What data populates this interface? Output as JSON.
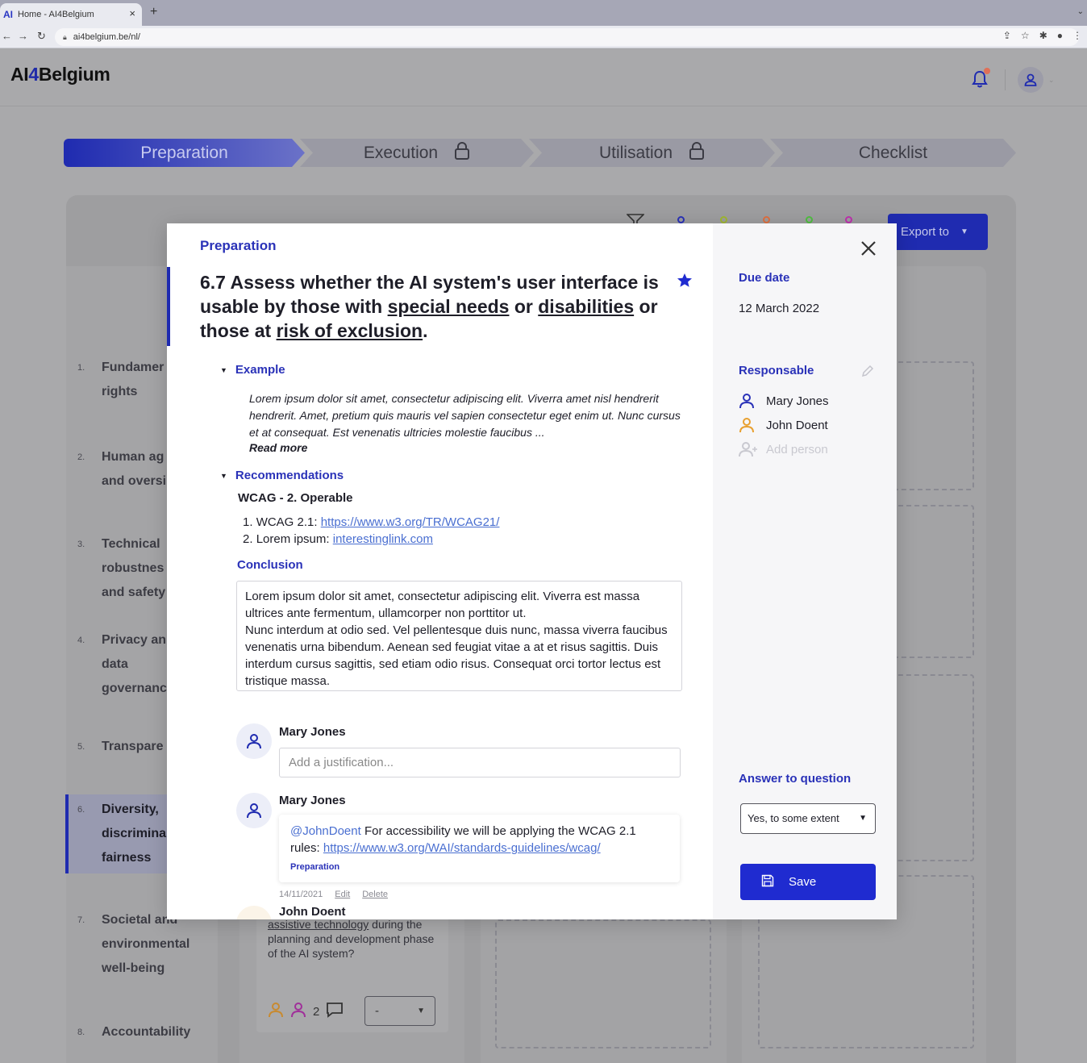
{
  "browser": {
    "tab_title": "Home - AI4Belgium",
    "favicon": "AI",
    "url": "ai4belgium.be/nl/",
    "new_tab": "+",
    "close_tab": "×"
  },
  "header": {
    "logo_part1": "AI",
    "logo_part2": "4",
    "logo_part3": "Belgium"
  },
  "stages": [
    {
      "label": "Preparation",
      "locked": false,
      "active": true
    },
    {
      "label": "Execution",
      "locked": true,
      "active": false
    },
    {
      "label": "Utilisation",
      "locked": true,
      "active": false
    },
    {
      "label": "Checklist",
      "locked": false,
      "active": false
    }
  ],
  "toolbar": {
    "export_label": "Export to",
    "filter_dot_colors": [
      "#2a32b8",
      "#a0b830",
      "#e07040",
      "#50c040",
      "#c030b0"
    ]
  },
  "sidebar": {
    "items": [
      {
        "num": "1.",
        "label": "Fundamer\nrights"
      },
      {
        "num": "2.",
        "label": "Human ag\nand oversi"
      },
      {
        "num": "3.",
        "label": "Technical\nrobustnes\nand safety"
      },
      {
        "num": "4.",
        "label": "Privacy an\ndata\ngovernanc"
      },
      {
        "num": "5.",
        "label": "Transpare"
      },
      {
        "num": "6.",
        "label": "Diversity,\ndiscrimina\nfairness"
      },
      {
        "num": "7.",
        "label": "Societal and\nenvironmental\nwell-being"
      },
      {
        "num": "8.",
        "label": "Accountability"
      }
    ]
  },
  "bg_card": {
    "text_underlined": "assistive technology",
    "text_rest": " during the planning and development phase of the AI system?",
    "comment_count": "2",
    "select_value": "-"
  },
  "modal": {
    "breadcrumb": "Preparation",
    "title_part1": "6.7 Assess whether the AI system's user interface is usable by those with ",
    "title_link1": "special needs",
    "title_part2": " or ",
    "title_link2": "disabilities",
    "title_part3": " or those at ",
    "title_link3": "risk of exclusion",
    "title_part4": ".",
    "example_heading": "Example",
    "example_text": "Lorem ipsum dolor sit amet, consectetur adipiscing elit. Viverra amet nisl hendrerit hendrerit. Amet, pretium quis mauris vel sapien consectetur eget enim ut. Nunc cursus et at consequat. Est venenatis ultricies molestie faucibus ...",
    "read_more": "Read more",
    "recommendations_heading": "Recommendations",
    "wcag_heading": "WCAG - 2. Operable",
    "recommendations": [
      {
        "num": "1.",
        "prefix": "WCAG 2.1: ",
        "link": "https://www.w3.org/TR/WCAG21/"
      },
      {
        "num": "2.",
        "prefix": "Lorem ipsum: ",
        "link": "interestinglink.com"
      }
    ],
    "conclusion_heading": "Conclusion",
    "conclusion_text_1": "Lorem ipsum dolor sit amet, consectetur adipiscing elit. Viverra est massa ultrices ante fermentum, ullamcorper non porttitor ut.",
    "conclusion_text_2": "Nunc interdum at odio sed. Vel pellentesque duis nunc, massa viverra faucibus venenatis urna bibendum. Aenean sed feugiat vitae a at et risus sagittis. Duis interdum cursus sagittis, sed etiam odio risus. Consequat orci tortor lectus est tristique massa.",
    "comments": {
      "new_author": "Mary Jones",
      "new_placeholder": "Add a justification...",
      "existing_author": "Mary Jones",
      "mention": "@JohnDoent",
      "text": " For accessibility we will be applying the WCAG 2.1 rules: ",
      "link": "https://www.w3.org/WAI/standards-guidelines/wcag/",
      "tag": "Preparation",
      "date": "14/11/2021",
      "edit": "Edit",
      "delete": "Delete",
      "next_author": "John Doent"
    },
    "side": {
      "due_label": "Due date",
      "due_value": "12 March 2022",
      "responsible_label": "Responsable",
      "people": [
        {
          "name": "Mary Jones",
          "color": "#2a32b8"
        },
        {
          "name": "John Doent",
          "color": "#e8a030"
        }
      ],
      "add_person": "Add person",
      "answer_label": "Answer to question",
      "answer_value": "Yes, to some extent",
      "save_label": "Save"
    }
  }
}
